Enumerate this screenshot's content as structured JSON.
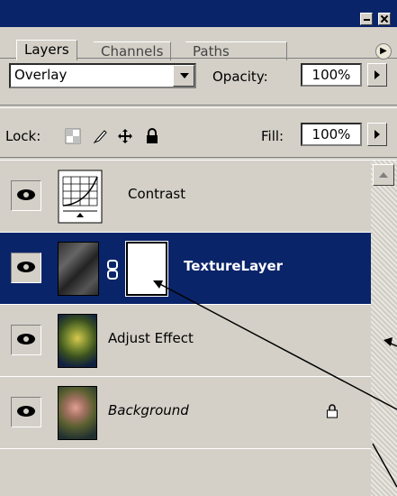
{
  "tabs": [
    {
      "label": "Layers"
    },
    {
      "label": "Channels"
    },
    {
      "label": "Paths"
    }
  ],
  "blend": {
    "mode": "Overlay",
    "opacity_label": "Opacity:",
    "opacity_value": "100%"
  },
  "lock": {
    "label": "Lock:",
    "fill_label": "Fill:",
    "fill_value": "100%"
  },
  "layers": [
    {
      "name": "Contrast",
      "type": "adjustment-curves"
    },
    {
      "name": "TextureLayer",
      "type": "texture-with-mask",
      "selected": true
    },
    {
      "name": "Adjust Effect",
      "type": "image"
    },
    {
      "name": "Background",
      "type": "image",
      "locked": true
    }
  ],
  "colors": {
    "titlebar": "#0a246a",
    "selection": "#0a246a",
    "panel": "#d4d0c8"
  }
}
